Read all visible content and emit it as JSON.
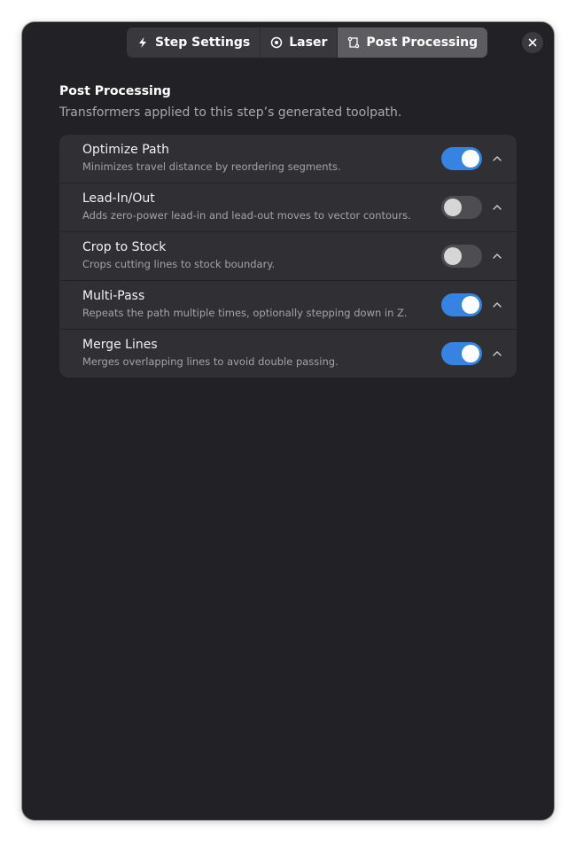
{
  "tabs": [
    {
      "label": "Step Settings",
      "icon": "lightning-icon",
      "active": false
    },
    {
      "label": "Laser",
      "icon": "target-icon",
      "active": false
    },
    {
      "label": "Post Processing",
      "icon": "transform-icon",
      "active": true
    }
  ],
  "close_icon": "close-icon",
  "section": {
    "title": "Post Processing",
    "description": "Transformers applied to this step’s generated toolpath."
  },
  "transformers": [
    {
      "title": "Optimize Path",
      "description": "Minimizes travel distance by reordering segments.",
      "enabled": true
    },
    {
      "title": "Lead-In/Out",
      "description": "Adds zero-power lead-in and lead-out moves to vector contours.",
      "enabled": false
    },
    {
      "title": "Crop to Stock",
      "description": "Crops cutting lines to stock boundary.",
      "enabled": false
    },
    {
      "title": "Multi-Pass",
      "description": "Repeats the path multiple times, optionally stepping down in Z.",
      "enabled": true
    },
    {
      "title": "Merge Lines",
      "description": "Merges overlapping lines to avoid double passing.",
      "enabled": true
    }
  ],
  "colors": {
    "accent": "#3584e4",
    "window_bg": "#222226",
    "card_bg": "#2f2f34"
  }
}
